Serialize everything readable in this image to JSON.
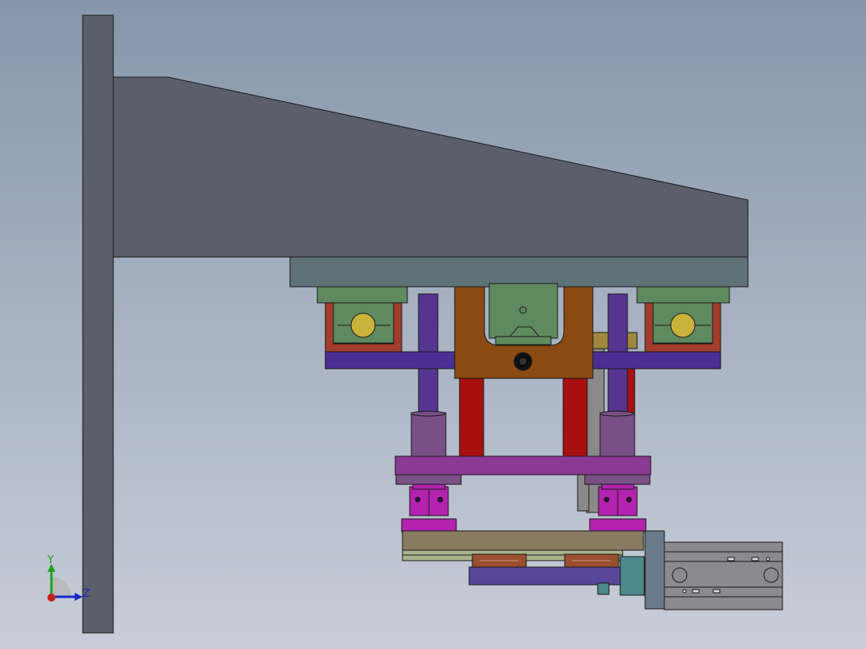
{
  "viewport": {
    "background_top": "#8796ab",
    "background_bottom": "#c8ced9"
  },
  "triad": {
    "y_label": "Y",
    "z_label": "Z",
    "y_color": "#22a022",
    "z_color": "#1a28c8",
    "x_color": "#c81e1e"
  },
  "colors": {
    "column": "#5a5f6b",
    "arm": "#5a5f6b",
    "mount_plate": "#5f7277",
    "slider_block": "#5f8a5f",
    "slider_bracket": "#a23d2e",
    "roller": "#c9b33a",
    "cross_bar": "#4b2f94",
    "guide_rod": "#563590",
    "guide_bushing": "#7a4f86",
    "center_carriage": "#8b4a12",
    "red_rod": "#a81010",
    "lift_plate": "#8a3a92",
    "clamp_block": "#b323b0",
    "base_rail": "#8a7a62",
    "guide_strip": "#a8b38a",
    "slide_bar": "#56479a",
    "slide_block": "#9a5030",
    "cylinder_body": "#8a8a8f",
    "cylinder_endcap": "#6a7a8a",
    "coupling": "#4a8a8a",
    "bracket_gray": "#8a8a8a",
    "brass_plate": "#a08840"
  }
}
